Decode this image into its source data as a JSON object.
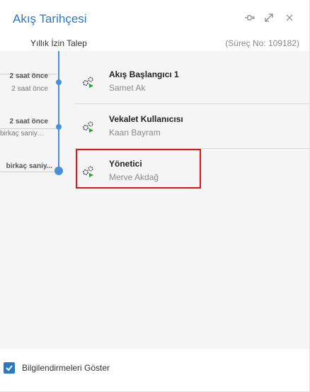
{
  "header": {
    "title": "Akış Tarihçesi",
    "icons": [
      "pin-icon",
      "expand-icon",
      "close-icon"
    ]
  },
  "subheader": {
    "title": "Yıllık İzin Talep",
    "process_no": "(Süreç No: 109182)"
  },
  "timeline": [
    {
      "time_main": "2 saat önce",
      "time_sub": "2 saat önce"
    },
    {
      "time_main": "2 saat önce",
      "time_sub": "birkaç saniye ..."
    },
    {
      "time_main": "birkaç saniy..."
    }
  ],
  "steps": [
    {
      "name": "Akış Başlangıcı 1",
      "user": "Samet Ak"
    },
    {
      "name": "Vekalet Kullanıcısı",
      "user": "Kaan Bayram"
    },
    {
      "name": "Yönetici",
      "user": "Merve Akdağ"
    }
  ],
  "footer": {
    "checkbox_label": "Bilgilendirmeleri Göster",
    "checked": true
  },
  "colors": {
    "accent": "#2b78c5",
    "timeline": "#4a90d9",
    "highlight": "#e0141b",
    "play": "#2e9e3a"
  }
}
